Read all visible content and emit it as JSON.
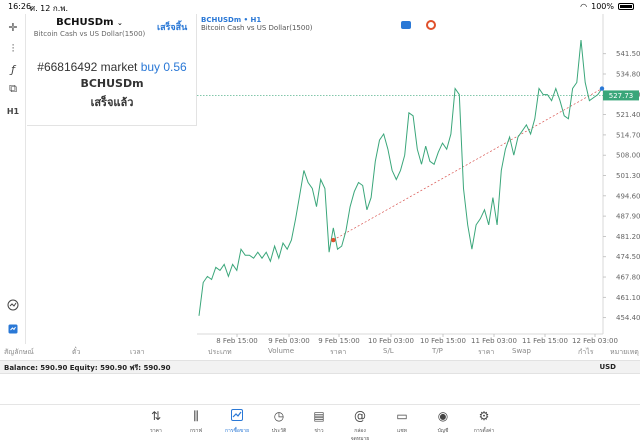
{
  "status_bar": {
    "time": "16:26",
    "date": "ศ. 12 ก.พ.",
    "battery": "100%"
  },
  "order_panel": {
    "symbol": "BCHUSDm",
    "description": "Bitcoin Cash vs US Dollar(1500)",
    "done_label": "เสร็จสิ้น",
    "order_text": "#66816492 market",
    "order_side": "buy 0.56",
    "order_symbol": "BCHUSDm",
    "status": "เสร็จแล้ว"
  },
  "chart_header": {
    "symbol_tf": "BCHUSDm • H1",
    "description": "Bitcoin Cash vs US Dollar(1500)",
    "current_price": "527.73"
  },
  "chart_data": {
    "type": "line",
    "title": "",
    "xlabel": "",
    "ylabel": "",
    "ylim": [
      449,
      548
    ],
    "y_ticks": [
      "541.50",
      "534.80",
      "528.10",
      "521.40",
      "514.70",
      "508.00",
      "501.30",
      "494.60",
      "487.90",
      "481.20",
      "474.50",
      "467.80",
      "461.10",
      "454.40"
    ],
    "x_ticks": [
      "8 Feb 15:00",
      "9 Feb 03:00",
      "9 Feb 15:00",
      "10 Feb 03:00",
      "10 Feb 15:00",
      "11 Feb 03:00",
      "11 Feb 15:00",
      "12 Feb 03:00"
    ],
    "series": [
      {
        "values": [
          455,
          466,
          468,
          467,
          471,
          470,
          472,
          468,
          472,
          470,
          477,
          475,
          475,
          474,
          476,
          474,
          476,
          473,
          478,
          474,
          479,
          477,
          480,
          487,
          495,
          503,
          499,
          497,
          491,
          500,
          497,
          476,
          484,
          477,
          478,
          483,
          491,
          496,
          499,
          498,
          490,
          494,
          506,
          513,
          515,
          510,
          503,
          500,
          503,
          508,
          522,
          521,
          510,
          505,
          511,
          506,
          505,
          509,
          512,
          510,
          515,
          530,
          528,
          497,
          485,
          477,
          485,
          487,
          490,
          485,
          494,
          485,
          503,
          510,
          514,
          508,
          514,
          516,
          518,
          515,
          520,
          530,
          528,
          528,
          526,
          530,
          526,
          521,
          520,
          530,
          532,
          546,
          532,
          526,
          527,
          528,
          530
        ]
      }
    ],
    "horizontal_line": 527.73,
    "trade_entry": {
      "x_index": 32,
      "price": 480.0
    }
  },
  "table_header": [
    "สัญลักษณ์",
    "ตั๋ว",
    "เวลา",
    "ประเภท",
    "Volume",
    "ราคา",
    "S/L",
    "T/P",
    "ราคา",
    "Swap",
    "กำไร",
    "หมายเหตุ"
  ],
  "balance_bar": {
    "text": "Balance: 590.90 Equity: 590.90 ฟรี: 590.90",
    "currency": "USD"
  },
  "bottom_nav": [
    {
      "label": "ราคา",
      "icon": "quotes-icon"
    },
    {
      "label": "กราฟ",
      "icon": "chart-icon"
    },
    {
      "label": "การซื้อขาย",
      "icon": "trade-icon"
    },
    {
      "label": "ประวัติ",
      "icon": "history-icon"
    },
    {
      "label": "ข่าว",
      "icon": "news-icon"
    },
    {
      "label": "กล่องจดหมาย",
      "icon": "mailbox-icon"
    },
    {
      "label": "แชท",
      "icon": "chat-icon"
    },
    {
      "label": "บัญชี",
      "icon": "accounts-icon"
    },
    {
      "label": "การตั้งค่า",
      "icon": "settings-icon"
    }
  ],
  "left_tools": [
    {
      "icon": "crosshair-icon",
      "glyph": "✛"
    },
    {
      "icon": "indicators-icon",
      "glyph": "⫶"
    },
    {
      "icon": "function-icon",
      "glyph": "ƒ"
    },
    {
      "icon": "objects-icon",
      "glyph": "⧉"
    },
    {
      "icon": "timeframe-icon",
      "glyph": "H1"
    }
  ],
  "colors": {
    "accent": "#2a78d6",
    "line": "#3aa67a",
    "price_line": "#3aa67a",
    "trade_line": "#d9534f"
  }
}
